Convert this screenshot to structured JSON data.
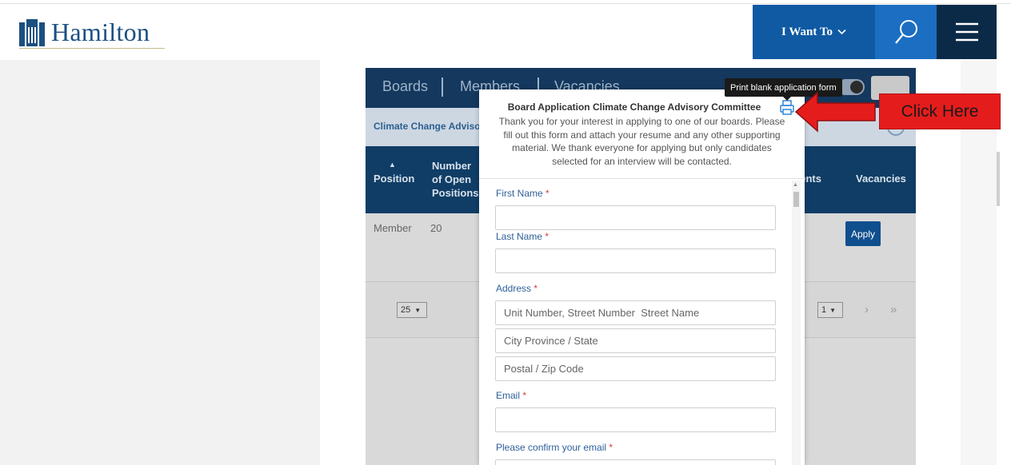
{
  "header": {
    "logo_text": "Hamilton",
    "want_label": "I Want To",
    "colors": {
      "brand": "#1b4f82",
      "want_bg": "#0f5aa3",
      "search_bg": "#1b6ec2",
      "menu_bg": "#0b2a48"
    }
  },
  "widget": {
    "tabs": [
      "Boards",
      "Members",
      "Vacancies"
    ],
    "sub_title": "Climate Change Advisory Committee",
    "columns": {
      "position": "Position",
      "open_positions": "Number of Open Positions",
      "appointments": "Appointments",
      "vacancies": "Vacancies"
    },
    "row": {
      "position": "Member",
      "open_positions": "20",
      "apply_label": "Apply"
    },
    "pager": {
      "page_size": "25",
      "page": "1",
      "next": "›",
      "last": "»"
    }
  },
  "modal": {
    "title": "Board Application Climate Change Advisory Committee",
    "intro": "Thank you for your interest in applying to one of our boards. Please fill out this form and attach your resume and any other supporting material. We thank everyone for applying but only candidates selected for an interview will be contacted.",
    "print_tooltip": "Print blank application form",
    "required_mark": "*",
    "fields": {
      "first_name_label": "First Name",
      "last_name_label": "Last Name",
      "address_label": "Address",
      "address_line_placeholder": "Unit Number, Street Number  Street Name",
      "city_placeholder": "City Province / State",
      "postal_placeholder": "Postal / Zip Code",
      "email_label": "Email",
      "confirm_email_label": "Please confirm your email"
    }
  },
  "annotation": {
    "label": "Click Here",
    "color": "#e51c1c"
  }
}
